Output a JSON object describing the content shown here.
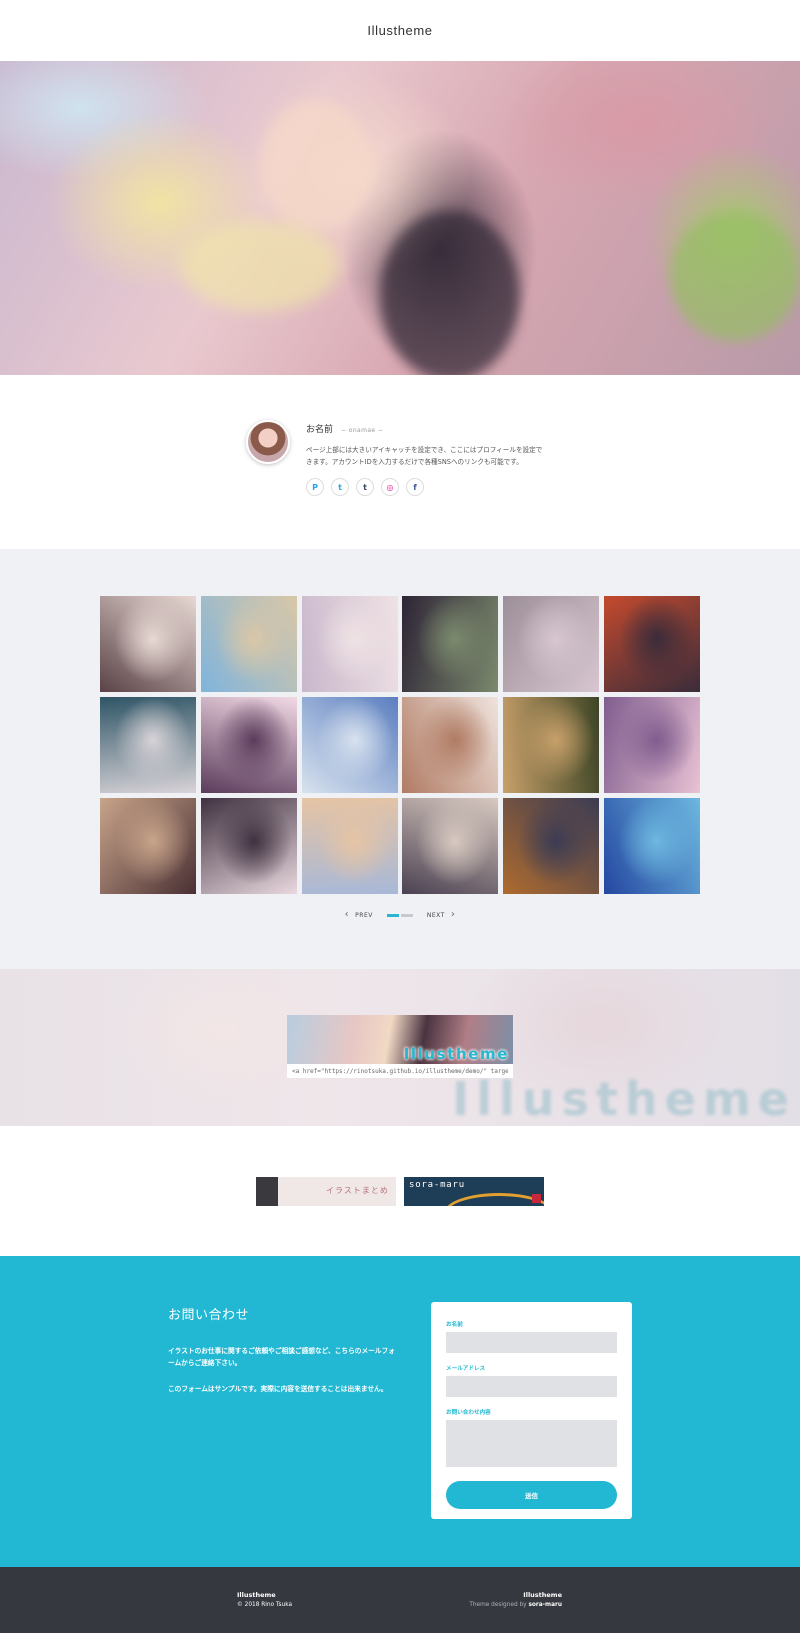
{
  "header": {
    "title": "Illustheme"
  },
  "profile": {
    "name": "お名前",
    "name_roman": "− onamae −",
    "bio_line1": "ページ上部には大きいアイキャッチを設定でき、ここにはプロフィールを設定で",
    "bio_line2": "きます。アカウントIDを入力するだけで各種SNSへのリンクも可能です。",
    "sns": [
      {
        "icon": "pixiv-icon",
        "glyph": "P",
        "color": "#2aa5e6"
      },
      {
        "icon": "twitter-icon",
        "glyph": "t",
        "color": "#2aa5e6"
      },
      {
        "icon": "tumblr-icon",
        "glyph": "t",
        "color": "#36465d"
      },
      {
        "icon": "instagram-icon",
        "glyph": "◎",
        "color": "#d6249f"
      },
      {
        "icon": "facebook-icon",
        "glyph": "f",
        "color": "#3b5998"
      }
    ]
  },
  "gallery": {
    "thumbnails": [
      [
        "#5a4246",
        "#e8d9d4"
      ],
      [
        "#7fb4dc",
        "#d9c7a7"
      ],
      [
        "#c8b7cc",
        "#efe2e4"
      ],
      [
        "#2e2436",
        "#7b8a6d"
      ],
      [
        "#9d8f99",
        "#d7c6cf"
      ],
      [
        "#c44a2e",
        "#3a2c3a"
      ],
      [
        "#2f5566",
        "#d8d3d8"
      ],
      [
        "#f1d9e4",
        "#5b3c5c"
      ],
      [
        "#5b7fc0",
        "#d8e2ee"
      ],
      [
        "#efe3dd",
        "#b07b63"
      ],
      [
        "#3d4526",
        "#c8a06a"
      ],
      [
        "#e9c2d4",
        "#7f5d8e"
      ],
      [
        "#4a3034",
        "#c8a48a"
      ],
      [
        "#e9d8de",
        "#3f3140"
      ],
      [
        "#a8b8d8",
        "#e6c4a4"
      ],
      [
        "#4b4252",
        "#d8c9c0"
      ],
      [
        "#ae6b2e",
        "#3c3c54"
      ],
      [
        "#2446a0",
        "#6db8e0"
      ]
    ],
    "pager": {
      "prev": "PREV",
      "next": "NEXT",
      "pages": 2,
      "current": 1
    }
  },
  "banner": {
    "title": "Illustheme",
    "code": "<a href=\"https://rinotsuka.github.io/illustheme/demo/\" target=\"_blank\">",
    "ghost_text": "Illustheme"
  },
  "links": {
    "banner1_text": "イラストまとめ",
    "banner2_text": "sora-maru"
  },
  "contact": {
    "heading": "お問い合わせ",
    "text1": "イラストのお仕事に関するご依頼やご相談ご感想など、こちらのメールフォームからご連絡下さい。",
    "text2": "このフォームはサンプルです。実際に内容を送信することは出来ません。",
    "form": {
      "name_label": "お名前",
      "email_label": "メールアドレス",
      "message_label": "お問い合わせ内容",
      "submit": "送信"
    }
  },
  "footer": {
    "left_title": "Illustheme",
    "copyright": "© 2018 Rino Tsuka",
    "right_title": "Illustheme",
    "credit_prefix": "Theme designed by ",
    "credit_name": "sora-maru"
  }
}
